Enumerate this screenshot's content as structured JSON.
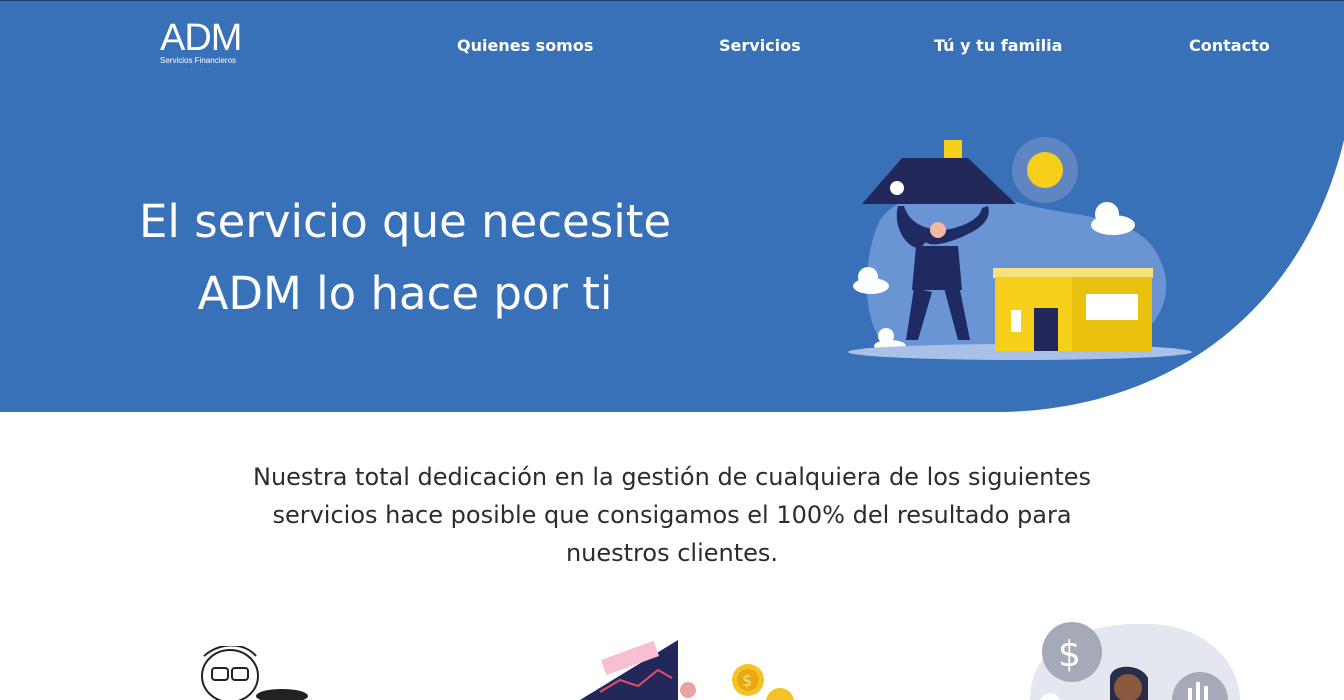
{
  "brand": {
    "logo_text": "ADM",
    "logo_subtitle": "Servicios Financieros",
    "logo_dots": "· · · · · ·"
  },
  "nav": {
    "items": [
      {
        "label": "Quienes somos"
      },
      {
        "label": "Servicios"
      },
      {
        "label": "Tú y tu familia"
      },
      {
        "label": "Contacto"
      }
    ]
  },
  "hero": {
    "line1": "El servicio que necesite",
    "line2": "ADM lo hace por ti",
    "background_color": "#3871b8"
  },
  "intro": {
    "text": "Nuestra total dedicación en la gestión de cualquiera de los siguientes servicios hace posible que consigamos el 100% del resultado para nuestros clientes."
  },
  "illustrations": {
    "hero": "person-holding-roof-over-house-illustration",
    "service_1": "woman-with-glasses-illustration",
    "service_2": "financial-chart-coins-illustration",
    "service_3": "person-with-dollar-and-chart-bubbles-illustration"
  }
}
